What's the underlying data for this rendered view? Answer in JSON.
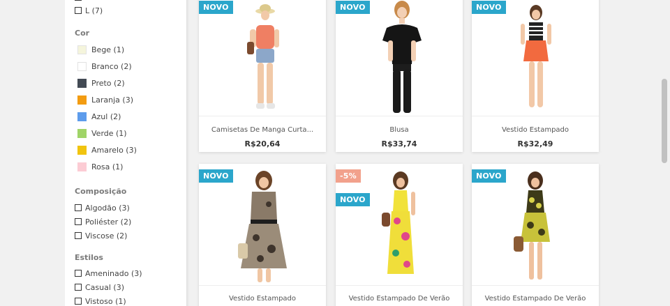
{
  "filters": {
    "size_items": [
      {
        "label": "L (7)"
      }
    ],
    "color": {
      "title": "Cor",
      "items": [
        {
          "label": "Bege (1)",
          "color": "#f5f5dc"
        },
        {
          "label": "Branco (2)",
          "color": "#ffffff"
        },
        {
          "label": "Preto (2)",
          "color": "#434a54"
        },
        {
          "label": "Laranja (3)",
          "color": "#f39c11"
        },
        {
          "label": "Azul (2)",
          "color": "#5d9cec"
        },
        {
          "label": "Verde (1)",
          "color": "#a0d468"
        },
        {
          "label": "Amarelo (3)",
          "color": "#f1c40f"
        },
        {
          "label": "Rosa (1)",
          "color": "#fcccd4"
        }
      ]
    },
    "composition": {
      "title": "Composição",
      "items": [
        {
          "label": "Algodão (3)"
        },
        {
          "label": "Poliéster (2)"
        },
        {
          "label": "Viscose (2)"
        }
      ]
    },
    "styles": {
      "title": "Estilos",
      "items": [
        {
          "label": "Ameninado (3)"
        },
        {
          "label": "Casual (3)"
        },
        {
          "label": "Vistoso (1)"
        }
      ]
    }
  },
  "products": [
    {
      "name": "Camisetas De Manga Curta...",
      "price": "R$20,64",
      "badge_new": "NOVO",
      "badge_sale": ""
    },
    {
      "name": "Blusa",
      "price": "R$33,74",
      "badge_new": "NOVO",
      "badge_sale": ""
    },
    {
      "name": "Vestido Estampado",
      "price": "R$32,49",
      "badge_new": "NOVO",
      "badge_sale": ""
    },
    {
      "name": "Vestido Estampado",
      "price": "",
      "badge_new": "NOVO",
      "badge_sale": ""
    },
    {
      "name": "Vestido Estampado De Verão",
      "price": "",
      "badge_new": "NOVO",
      "badge_sale": "-5%"
    },
    {
      "name": "Vestido Estampado De Verão",
      "price": "",
      "badge_new": "NOVO",
      "badge_sale": ""
    }
  ]
}
